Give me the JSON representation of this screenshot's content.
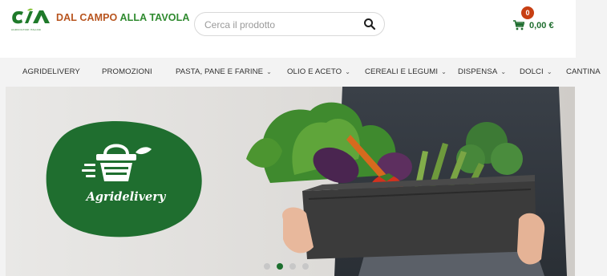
{
  "brand": {
    "logo_sub": "AGRICOLTORI ITALIANI",
    "name_part1": "DAL CAMPO",
    "name_part2": "ALLA TAVOLA",
    "brown": "#b8551f",
    "green": "#2f8a2f"
  },
  "search": {
    "placeholder": "Cerca il prodotto",
    "value": ""
  },
  "cart": {
    "count": "0",
    "total": "0,00 €",
    "badge_color": "#c73f13"
  },
  "nav": {
    "items": [
      {
        "label": "AGRIDELIVERY",
        "dropdown": false
      },
      {
        "label": "PROMOZIONI",
        "dropdown": false
      },
      {
        "label": "PASTA, PANE E FARINE",
        "dropdown": true
      },
      {
        "label": "OLIO E ACETO",
        "dropdown": true
      },
      {
        "label": "CEREALI E LEGUMI",
        "dropdown": true
      },
      {
        "label": "DISPENSA",
        "dropdown": true
      },
      {
        "label": "DOLCI",
        "dropdown": true
      },
      {
        "label": "CANTINA",
        "dropdown": false
      }
    ],
    "chevron_glyph": "⌄"
  },
  "banner": {
    "badge_text": "Agridelivery",
    "badge_color": "#1f6e2f",
    "slides": 4,
    "active_slide": 2
  }
}
